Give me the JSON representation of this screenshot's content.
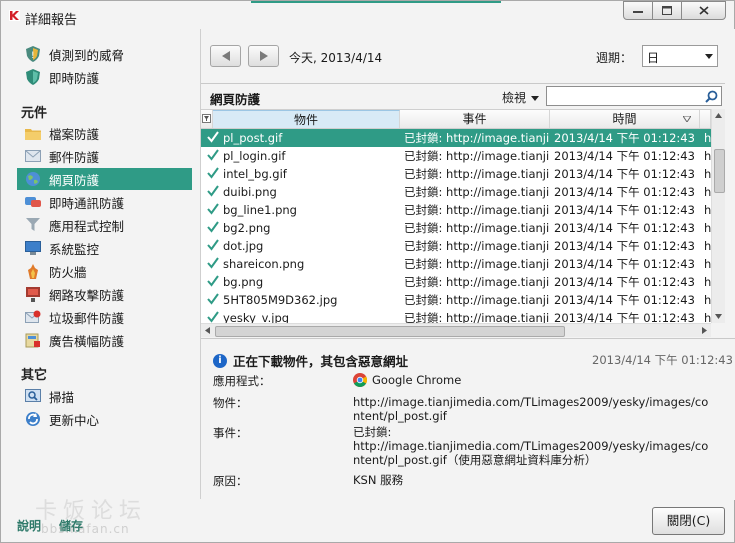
{
  "window": {
    "title": "詳細報告",
    "controls": {
      "minimize": "▭",
      "maximize": "☐",
      "close": "✕"
    }
  },
  "sidebar": {
    "top_items": [
      {
        "label": "偵測到的威脅",
        "icon": "threat-shield-icon"
      },
      {
        "label": "即時防護",
        "icon": "protection-shield-icon"
      }
    ],
    "sections": [
      {
        "heading": "元件",
        "items": [
          {
            "label": "檔案防護",
            "icon": "folder-icon"
          },
          {
            "label": "郵件防護",
            "icon": "mail-icon"
          },
          {
            "label": "網頁防護",
            "icon": "globe-icon",
            "active": true
          },
          {
            "label": "即時通訊防護",
            "icon": "im-icon"
          },
          {
            "label": "應用程式控制",
            "icon": "funnel-icon"
          },
          {
            "label": "系統監控",
            "icon": "monitor-icon"
          },
          {
            "label": "防火牆",
            "icon": "firewall-icon"
          },
          {
            "label": "網路攻擊防護",
            "icon": "network-attack-icon"
          },
          {
            "label": "垃圾郵件防護",
            "icon": "antispam-icon"
          },
          {
            "label": "廣告橫幅防護",
            "icon": "banner-icon"
          }
        ]
      },
      {
        "heading": "其它",
        "items": [
          {
            "label": "掃描",
            "icon": "scan-icon"
          },
          {
            "label": "更新中心",
            "icon": "update-icon"
          }
        ]
      }
    ]
  },
  "toolbar": {
    "date": "今天, 2013/4/14",
    "period_label": "週期：",
    "period_value": "日"
  },
  "panel": {
    "title": "網頁防護",
    "view_label": "檢視",
    "search_placeholder": ""
  },
  "table": {
    "columns": [
      "物件",
      "事件",
      "時間"
    ],
    "rows": [
      {
        "object": "pl_post.gif",
        "event": "已封鎖: http://image.tianji...",
        "time": "2013/4/14 下午 01:12:43",
        "extra": "h",
        "selected": true
      },
      {
        "object": "pl_login.gif",
        "event": "已封鎖: http://image.tianji...",
        "time": "2013/4/14 下午 01:12:43",
        "extra": "h"
      },
      {
        "object": "intel_bg.gif",
        "event": "已封鎖: http://image.tianji...",
        "time": "2013/4/14 下午 01:12:43",
        "extra": "h"
      },
      {
        "object": "duibi.png",
        "event": "已封鎖: http://image.tianji...",
        "time": "2013/4/14 下午 01:12:43",
        "extra": "h"
      },
      {
        "object": "bg_line1.png",
        "event": "已封鎖: http://image.tianji...",
        "time": "2013/4/14 下午 01:12:43",
        "extra": "h"
      },
      {
        "object": "bg2.png",
        "event": "已封鎖: http://image.tianji...",
        "time": "2013/4/14 下午 01:12:43",
        "extra": "h"
      },
      {
        "object": "dot.jpg",
        "event": "已封鎖: http://image.tianji...",
        "time": "2013/4/14 下午 01:12:43",
        "extra": "h"
      },
      {
        "object": "shareicon.png",
        "event": "已封鎖: http://image.tianji...",
        "time": "2013/4/14 下午 01:12:43",
        "extra": "h"
      },
      {
        "object": "bg.png",
        "event": "已封鎖: http://image.tianji...",
        "time": "2013/4/14 下午 01:12:43",
        "extra": "h"
      },
      {
        "object": "5HT805M9D362.jpg",
        "event": "已封鎖: http://image.tianji...",
        "time": "2013/4/14 下午 01:12:43",
        "extra": "h"
      },
      {
        "object": "yesky_v.jpg",
        "event": "已封鎖: http://image.tianji...",
        "time": "2013/4/14 下午 01:12:43",
        "extra": "h"
      }
    ]
  },
  "detail": {
    "heading": "正在下載物件，其包含惡意網址",
    "time": "2013/4/14 下午 01:12:43",
    "fields": {
      "app_label": "應用程式：",
      "app_value": "Google Chrome",
      "object_label": "物件：",
      "object_value": "http://image.tianjimedia.com/TLimages2009/yesky/images/content/pl_post.gif",
      "event_label": "事件：",
      "event_value_1": "已封鎖:",
      "event_value_2": "http://image.tianjimedia.com/TLimages2009/yesky/images/content/pl_post.gif（使用惡意網址資料庫分析）",
      "reason_label": "原因：",
      "reason_value": "KSN 服務"
    }
  },
  "footer": {
    "help": "說明",
    "save": "儲存",
    "close": "關閉(C)",
    "watermark": "卡饭论坛",
    "watermark_url": "bbs.kafan.cn"
  },
  "colors": {
    "accent": "#2f9b86",
    "brand_red": "#d4212a",
    "info_blue": "#1d66c7"
  }
}
